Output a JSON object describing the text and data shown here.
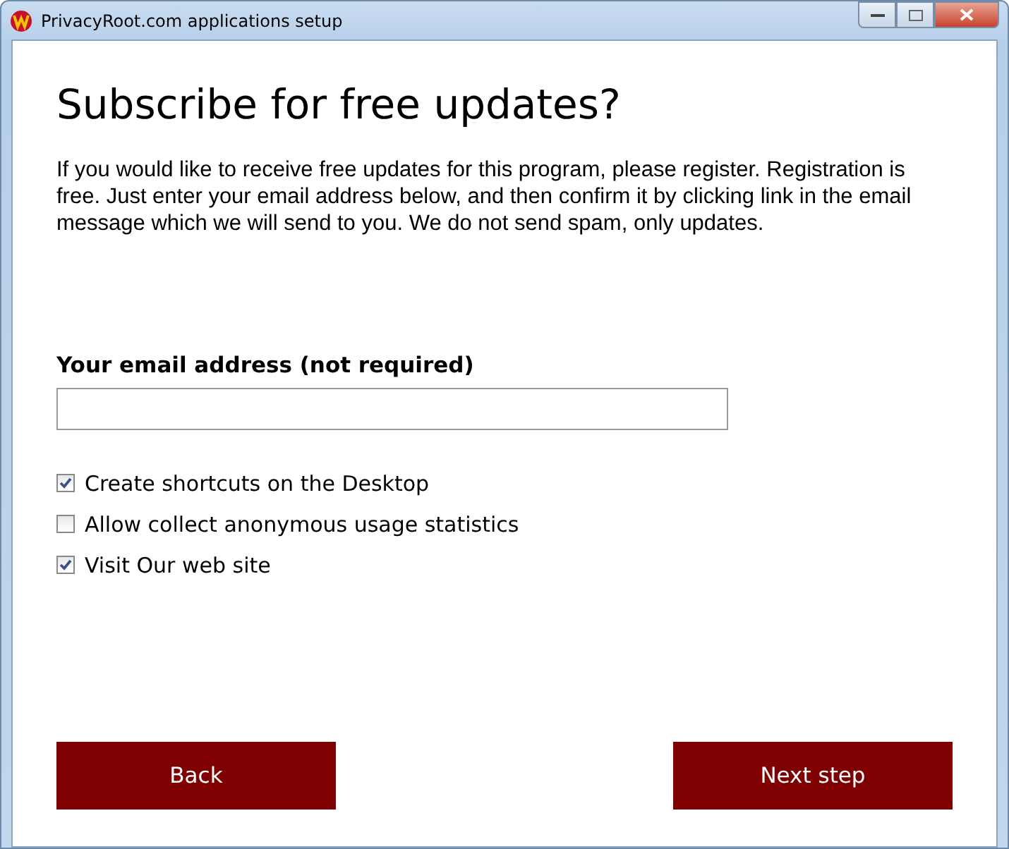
{
  "window": {
    "title": "PrivacyRoot.com applications setup"
  },
  "heading": "Subscribe for free updates?",
  "intro": "If you would like to receive free updates for this program, please register. Registration is free. Just enter your email address below, and then confirm it by clicking link in the email message which we will send to you. We do not send spam, only updates.",
  "email": {
    "label": "Your email address (not required)"
  },
  "options": [
    {
      "label": "Create shortcuts on the Desktop",
      "checked": true
    },
    {
      "label": "Allow collect anonymous usage statistics",
      "checked": false
    },
    {
      "label": "Visit Our web site",
      "checked": true
    }
  ],
  "buttons": [
    "Back",
    "Next step"
  ]
}
